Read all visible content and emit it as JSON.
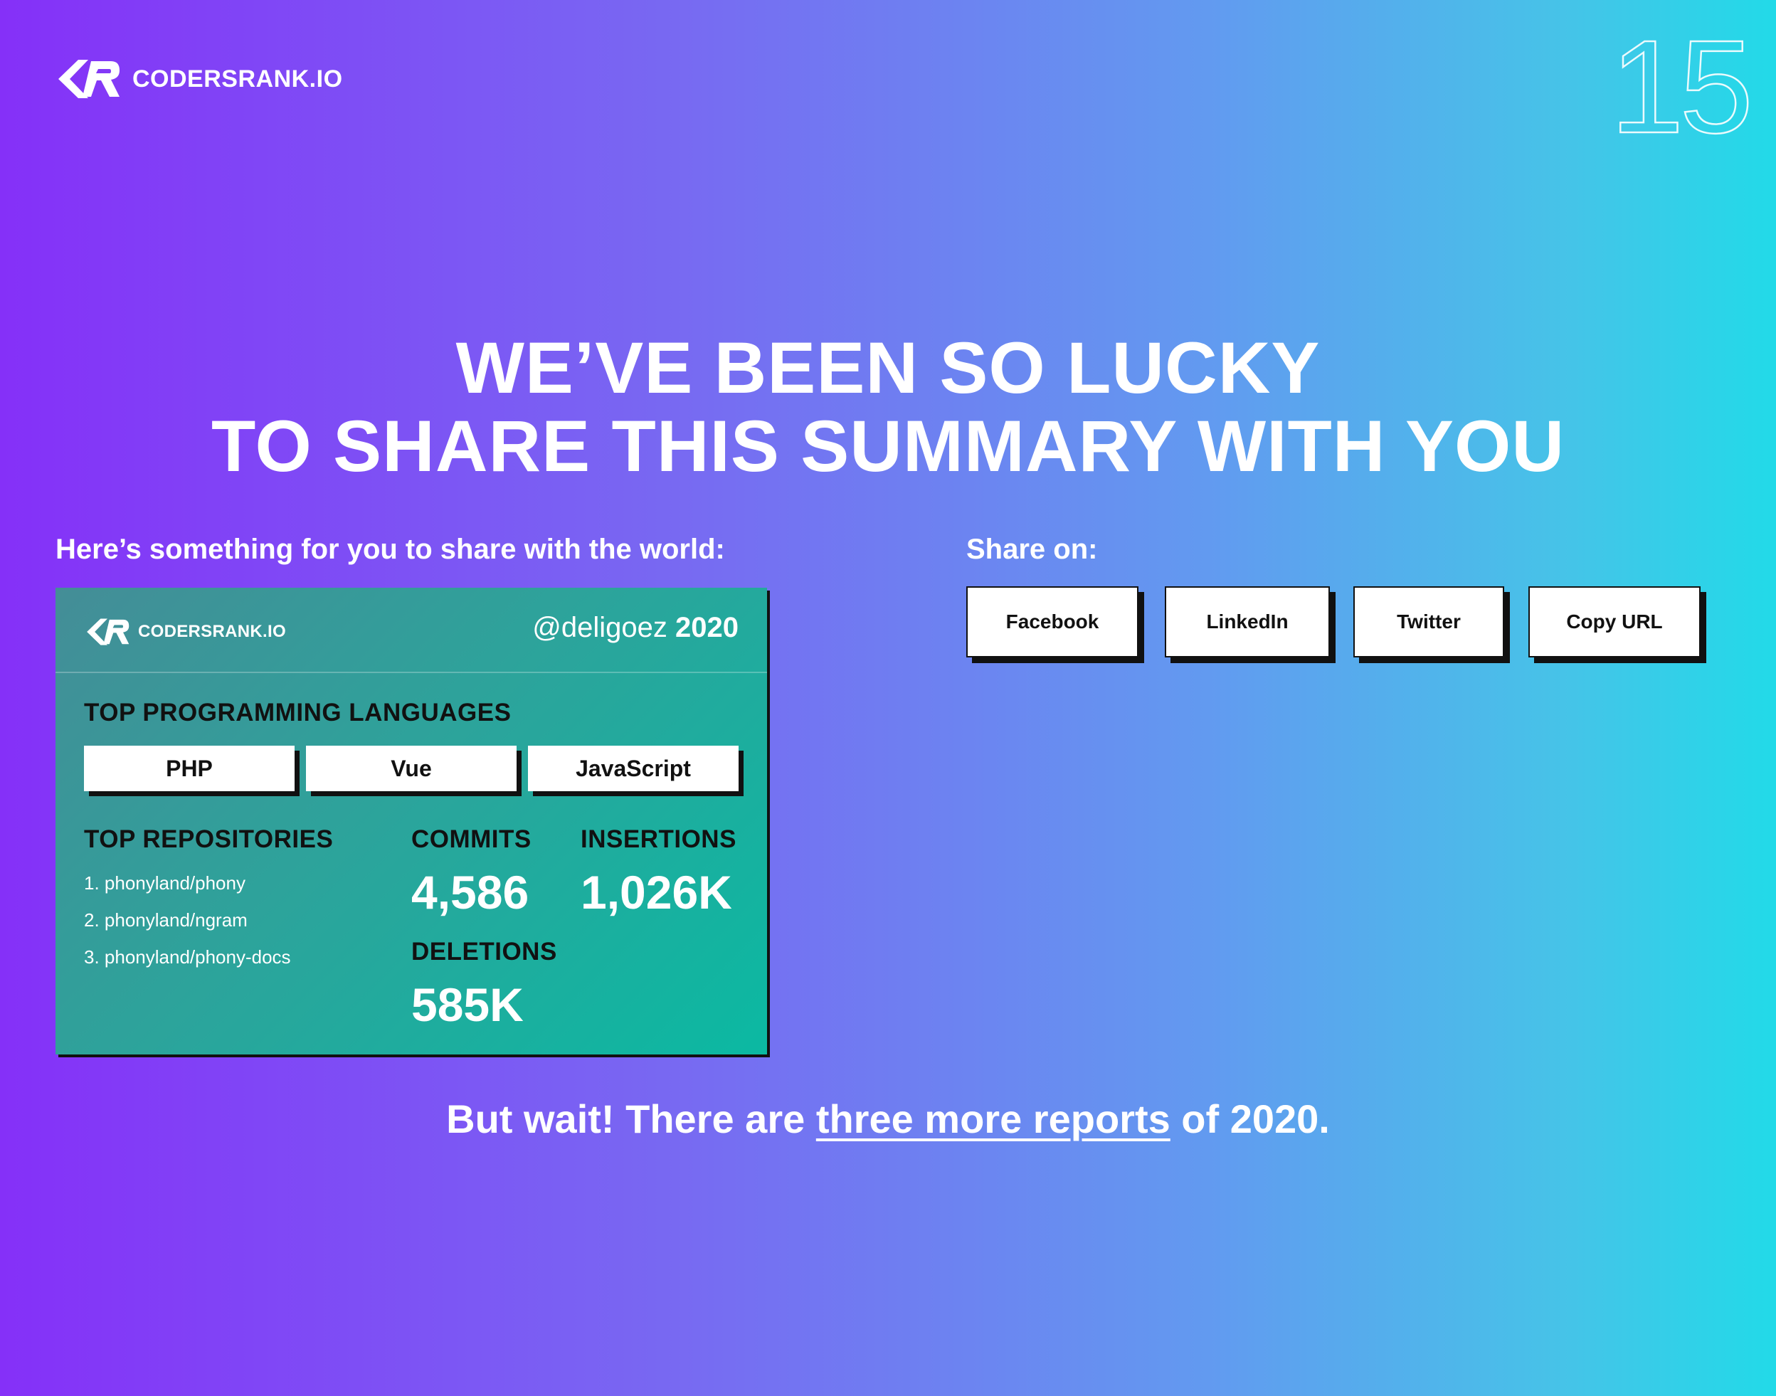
{
  "brand": {
    "name": "CODERSRANK.IO"
  },
  "page_number": "15",
  "headline": {
    "line1": "WE’VE BEEN SO LUCKY",
    "line2": "TO SHARE THIS SUMMARY WITH YOU"
  },
  "share_intro": "Here’s something for you to share with the world:",
  "share": {
    "label": "Share on:",
    "buttons": [
      "Facebook",
      "LinkedIn",
      "Twitter",
      "Copy URL"
    ]
  },
  "card": {
    "brand": "CODERSRANK.IO",
    "username": "@deligoez",
    "year": "2020",
    "languages_title": "TOP PROGRAMMING LANGUAGES",
    "languages": [
      "PHP",
      "Vue",
      "JavaScript"
    ],
    "repos_title": "TOP REPOSITORIES",
    "repos": [
      "1. phonyland/phony",
      "2. phonyland/ngram",
      "3. phonyland/phony-docs"
    ],
    "commits_label": "COMMITS",
    "commits_value": "4,586",
    "insertions_label": "INSERTIONS",
    "insertions_value": "1,026K",
    "deletions_label": "DELETIONS",
    "deletions_value": "585K"
  },
  "footer": {
    "before": "But wait! There are ",
    "link": "three more reports",
    "after": " of 2020."
  },
  "colors": {
    "gradient_start": "#8530f8",
    "gradient_end": "#22dae8",
    "card_start": "#448d97",
    "card_end": "#0bb9a2",
    "button_bg": "#ffffff",
    "shadow": "#111111"
  },
  "icons": [
    "codersrank-logo-icon"
  ]
}
